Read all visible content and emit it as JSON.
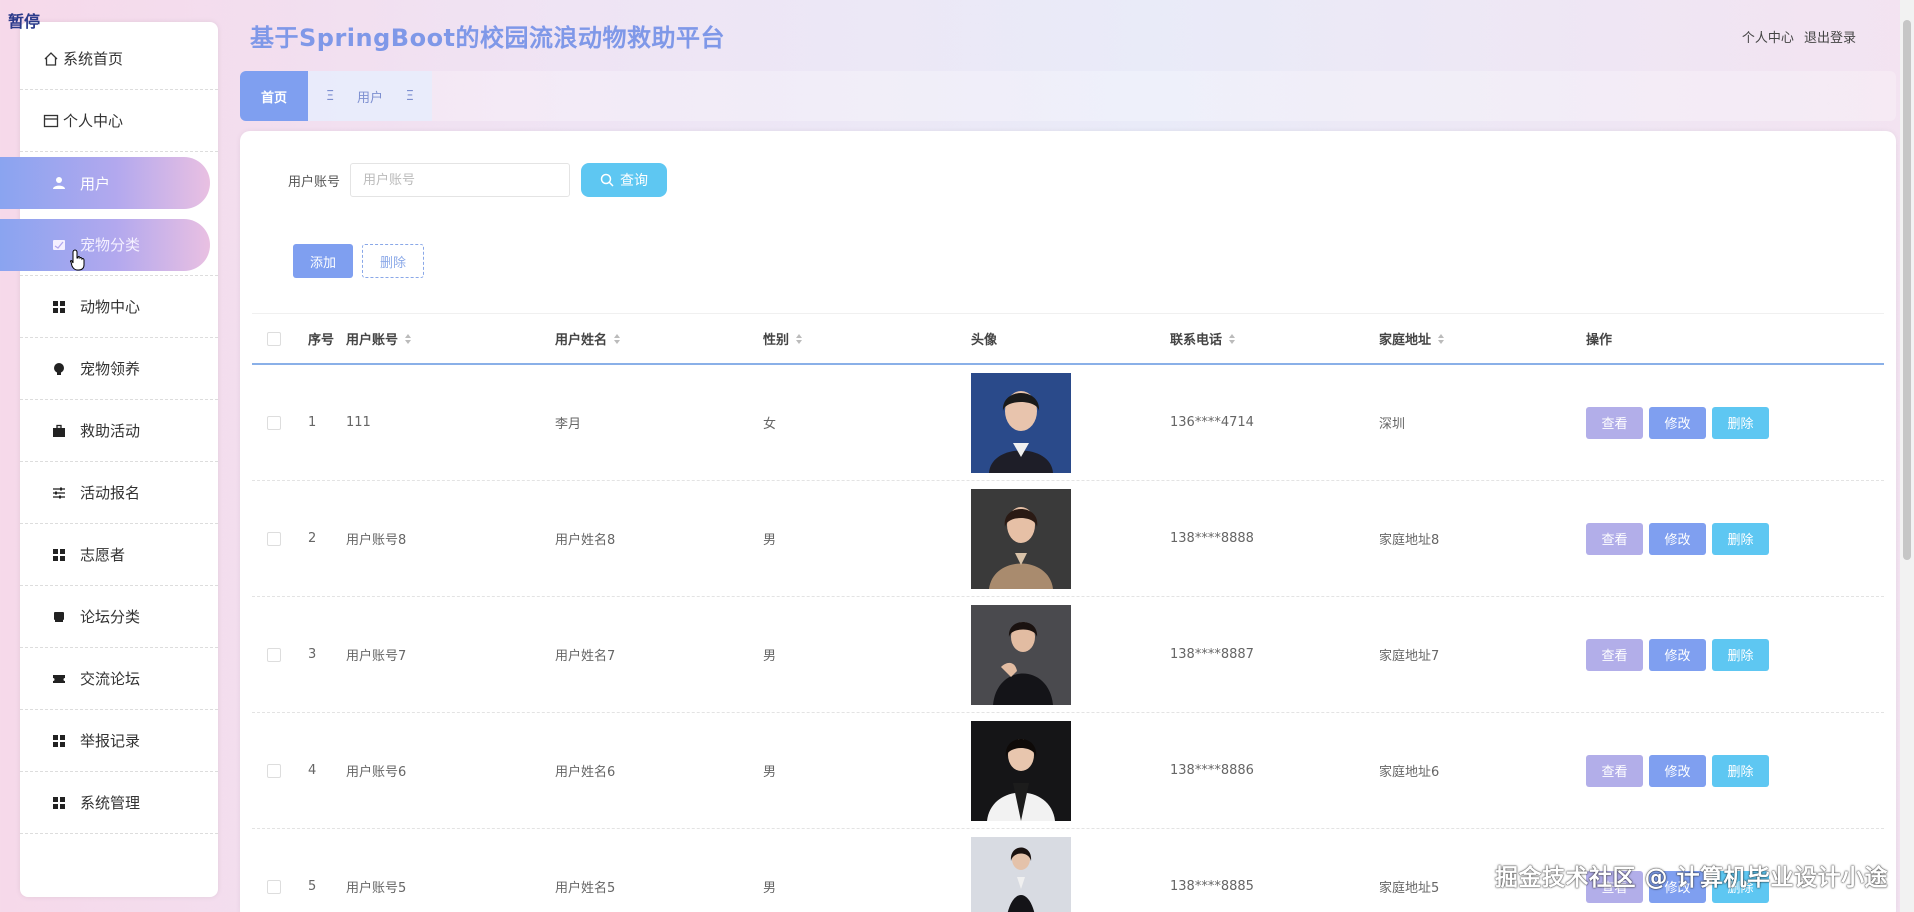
{
  "overlay": {
    "pause": "暂停",
    "watermark": "掘金技术社区 @ 计算机毕业设计小途"
  },
  "header": {
    "title": "基于SpringBoot的校园流浪动物救助平台",
    "personal_center": "个人中心",
    "logout": "退出登录"
  },
  "sidebar": {
    "items": [
      {
        "label": "系统首页",
        "icon": "home-icon"
      },
      {
        "label": "个人中心",
        "icon": "card-icon"
      },
      {
        "label": "用户",
        "icon": "user-icon"
      },
      {
        "label": "宠物分类",
        "icon": "folder-icon"
      },
      {
        "label": "动物中心",
        "icon": "grid-icon"
      },
      {
        "label": "宠物领养",
        "icon": "bulb-icon"
      },
      {
        "label": "救助活动",
        "icon": "briefcase-icon"
      },
      {
        "label": "活动报名",
        "icon": "sliders-icon"
      },
      {
        "label": "志愿者",
        "icon": "grid-icon"
      },
      {
        "label": "论坛分类",
        "icon": "chat-icon"
      },
      {
        "label": "交流论坛",
        "icon": "ticket-icon"
      },
      {
        "label": "举报记录",
        "icon": "grid-icon"
      },
      {
        "label": "系统管理",
        "icon": "grid-icon"
      }
    ]
  },
  "tabs": {
    "home": "首页",
    "user": "用户"
  },
  "search": {
    "label": "用户账号",
    "placeholder": "用户账号",
    "button": "查询"
  },
  "actions": {
    "add": "添加",
    "delete": "删除"
  },
  "table": {
    "headers": {
      "idx": "序号",
      "account": "用户账号",
      "name": "用户姓名",
      "gender": "性别",
      "avatar": "头像",
      "phone": "联系电话",
      "address": "家庭地址",
      "ops": "操作"
    },
    "ops": {
      "view": "查看",
      "edit": "修改",
      "delete": "删除"
    },
    "rows": [
      {
        "idx": "1",
        "account": "111",
        "name": "李月",
        "gender": "女",
        "phone": "136****4714",
        "address": "深圳"
      },
      {
        "idx": "2",
        "account": "用户账号8",
        "name": "用户姓名8",
        "gender": "男",
        "phone": "138****8888",
        "address": "家庭地址8"
      },
      {
        "idx": "3",
        "account": "用户账号7",
        "name": "用户姓名7",
        "gender": "男",
        "phone": "138****8887",
        "address": "家庭地址7"
      },
      {
        "idx": "4",
        "account": "用户账号6",
        "name": "用户姓名6",
        "gender": "男",
        "phone": "138****8886",
        "address": "家庭地址6"
      },
      {
        "idx": "5",
        "account": "用户账号5",
        "name": "用户姓名5",
        "gender": "男",
        "phone": "138****8885",
        "address": "家庭地址5"
      }
    ]
  },
  "colors": {
    "accent": "#7f9ff0",
    "cyan": "#5ec7f2",
    "lavender": "#b2aee9",
    "title": "#7f98e8"
  }
}
